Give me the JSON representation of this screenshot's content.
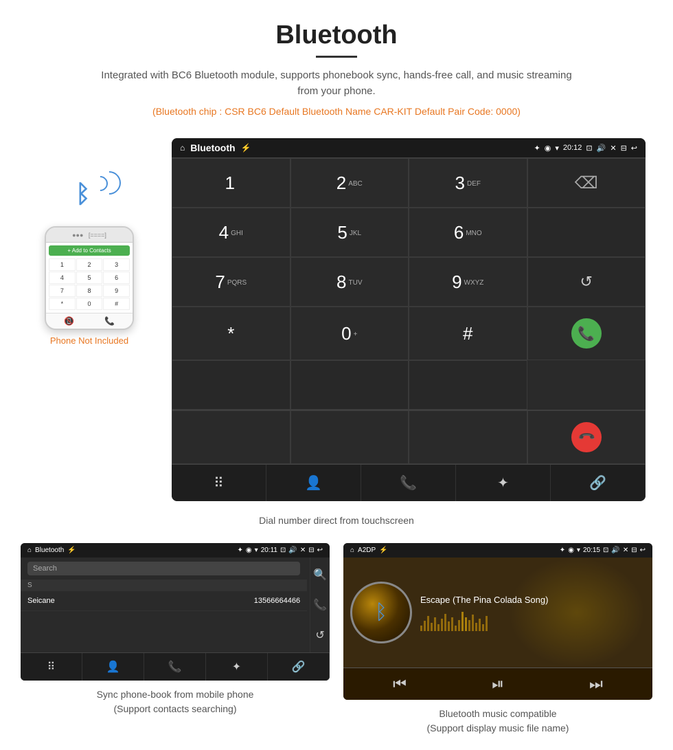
{
  "header": {
    "title": "Bluetooth",
    "description": "Integrated with BC6 Bluetooth module, supports phonebook sync, hands-free call, and music streaming from your phone.",
    "tech_info": "(Bluetooth chip : CSR BC6    Default Bluetooth Name CAR-KIT    Default Pair Code: 0000)"
  },
  "dialpad_screen": {
    "title": "Bluetooth",
    "time": "20:12",
    "keys": [
      {
        "num": "1",
        "sub": ""
      },
      {
        "num": "2",
        "sub": "ABC"
      },
      {
        "num": "3",
        "sub": "DEF"
      },
      {
        "num": "4",
        "sub": "GHI"
      },
      {
        "num": "5",
        "sub": "JKL"
      },
      {
        "num": "6",
        "sub": "MNO"
      },
      {
        "num": "7",
        "sub": "PQRS"
      },
      {
        "num": "8",
        "sub": "TUV"
      },
      {
        "num": "9",
        "sub": "WXYZ"
      },
      {
        "num": "*",
        "sub": ""
      },
      {
        "num": "0",
        "sub": "+"
      },
      {
        "num": "#",
        "sub": ""
      }
    ],
    "caption": "Dial number direct from touchscreen"
  },
  "phone_not_included": "Phone Not Included",
  "phonebook_screen": {
    "title": "Bluetooth",
    "time": "20:11",
    "search_placeholder": "Search",
    "section": "S",
    "contact_name": "Seicane",
    "contact_phone": "13566664466",
    "caption_line1": "Sync phone-book from mobile phone",
    "caption_line2": "(Support contacts searching)"
  },
  "music_screen": {
    "title": "A2DP",
    "time": "20:15",
    "song_title": "Escape (The Pina Colada Song)",
    "caption_line1": "Bluetooth music compatible",
    "caption_line2": "(Support display music file name)"
  },
  "icons": {
    "home": "⌂",
    "back": "↩",
    "bluetooth": "✦",
    "camera": "📷",
    "volume": "🔊",
    "close": "✕",
    "window": "⊟",
    "usb": "⚡",
    "location": "◉",
    "wifi": "▾",
    "backspace": "⌫",
    "refresh": "↺",
    "call_green": "📞",
    "call_end": "📞",
    "dialpad_icon": "⠿",
    "person_icon": "👤",
    "phone_icon": "📞",
    "bt_icon": "✦",
    "link_icon": "🔗",
    "search_icon": "🔍",
    "prev": "⏮",
    "play": "⏯",
    "next": "⏭"
  }
}
